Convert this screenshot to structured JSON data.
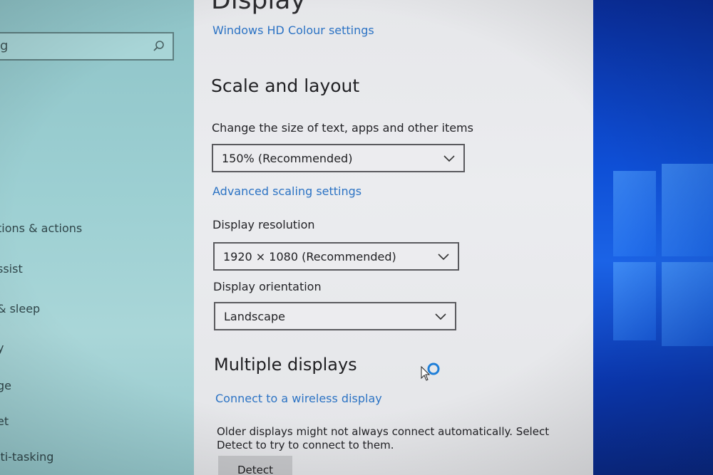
{
  "sidebar": {
    "search": {
      "value": "g"
    },
    "items": [
      {
        "label": "tions & actions"
      },
      {
        "label": "ssist"
      },
      {
        "label": "& sleep"
      },
      {
        "label": "y"
      },
      {
        "label": "ge"
      },
      {
        "label": "et"
      },
      {
        "label": "lti-tasking"
      }
    ]
  },
  "main": {
    "title": "Display",
    "hd_colour_link": "Windows HD Colour settings",
    "scale_section": {
      "title": "Scale and layout",
      "size_label": "Change the size of text, apps and other items",
      "size_value": "150% (Recommended)",
      "advanced_link": "Advanced scaling settings",
      "resolution_label": "Display resolution",
      "resolution_value": "1920 × 1080 (Recommended)",
      "orientation_label": "Display orientation",
      "orientation_value": "Landscape"
    },
    "multiple_section": {
      "title": "Multiple displays",
      "wireless_link": "Connect to a wireless display",
      "description": "Older displays might not always connect automatically. Select Detect to try to connect to them.",
      "detect_button": "Detect"
    }
  },
  "icons": {
    "search": "search-icon",
    "chevron": "chevron-down-icon",
    "busy": "busy-spinner-icon",
    "pointer": "mouse-pointer-icon"
  },
  "colors": {
    "link": "#2c73c4",
    "sidebar_bg": "#9ccfd2",
    "main_bg": "#ebecef",
    "desktop_accent": "#0e4fd6"
  }
}
